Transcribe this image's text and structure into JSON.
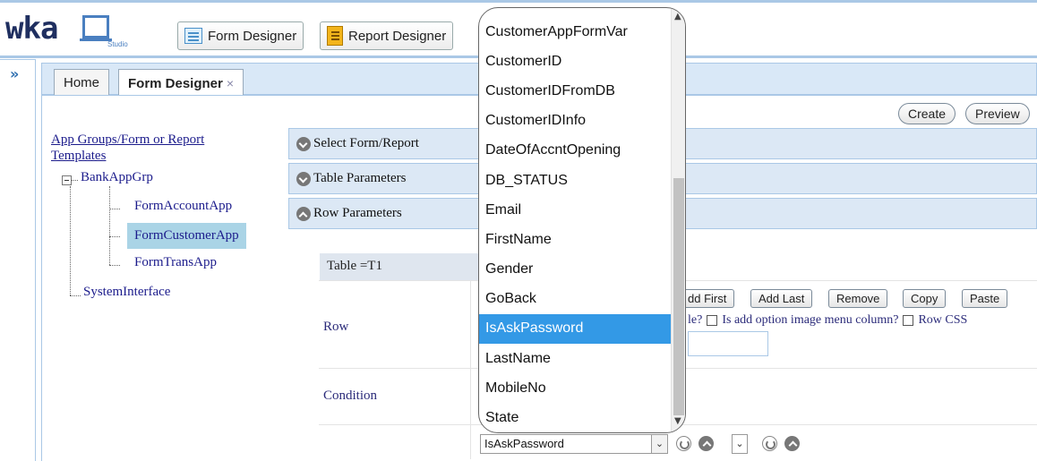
{
  "app": {
    "logo_text": "wka",
    "logo_sub": "Studio"
  },
  "toolbar": {
    "form_designer": "Form Designer",
    "report_designer": "Report Designer"
  },
  "tabs": [
    {
      "label": "Home"
    },
    {
      "label": "Form Designer",
      "close": "×"
    }
  ],
  "actions": {
    "create": "Create",
    "preview": "Preview"
  },
  "tree": {
    "root_label": "App Groups/Form or Report Templates",
    "group": "BankAppGrp",
    "forms": [
      "FormAccountApp",
      "FormCustomerApp",
      "FormTransApp"
    ],
    "selected": "FormCustomerApp",
    "other": "SystemInterface"
  },
  "accordion": [
    {
      "label": "Select Form/Report"
    },
    {
      "label": "Table Parameters"
    },
    {
      "label": "Row Parameters"
    }
  ],
  "form": {
    "table_label": "Table =T1",
    "row_label": "Row",
    "condition_label": "Condition",
    "buttons": [
      "dd First",
      "Add Last",
      "Remove",
      "Copy",
      "Paste"
    ],
    "row_options_text_1": "le?",
    "row_options_text_2": "Is add option image menu column?",
    "row_options_text_3": "Row CSS"
  },
  "dropdown": {
    "items": [
      "CustomerAppFormVar",
      "CustomerID",
      "CustomerIDFromDB",
      "CustomerIDInfo",
      "DateOfAccntOpening",
      "DB_STATUS",
      "Email",
      "FirstName",
      "Gender",
      "GoBack",
      "IsAskPassword",
      "LastName",
      "MobileNo",
      "State"
    ],
    "highlighted": "IsAskPassword"
  },
  "select": {
    "value": "IsAskPassword"
  },
  "colors": {
    "highlight": "#3399e6",
    "accordion_bg": "#dce8f5",
    "tree_selected": "#aad4e6"
  }
}
